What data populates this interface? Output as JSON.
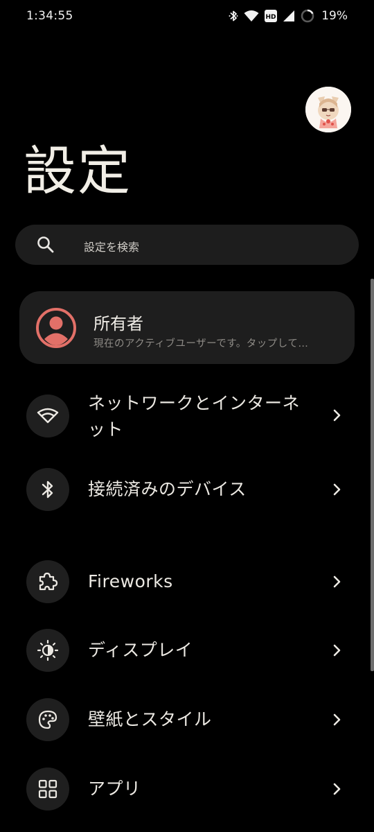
{
  "status_bar": {
    "time": "1:34:55",
    "battery": "19%",
    "icons": [
      "bluetooth-icon",
      "wifi-icon",
      "hd-badge-icon",
      "signal-icon",
      "battery-icon"
    ]
  },
  "header": {
    "title": "設定"
  },
  "search": {
    "placeholder": "設定を検索"
  },
  "owner": {
    "title": "所有者",
    "subtitle": "現在のアクティブユーザーです。タップして…"
  },
  "items": [
    {
      "label": "ネットワークとインターネット",
      "icon": "wifi-icon"
    },
    {
      "label": "接続済みのデバイス",
      "icon": "bluetooth-icon"
    },
    {
      "label": "Fireworks",
      "icon": "puzzle-icon"
    },
    {
      "label": "ディスプレイ",
      "icon": "brightness-icon"
    },
    {
      "label": "壁紙とスタイル",
      "icon": "palette-icon"
    },
    {
      "label": "アプリ",
      "icon": "apps-grid-icon"
    }
  ],
  "colors": {
    "background": "#000000",
    "card": "#1e1e1e",
    "owner_icon": "#e27068",
    "text": "#ece9e3"
  }
}
